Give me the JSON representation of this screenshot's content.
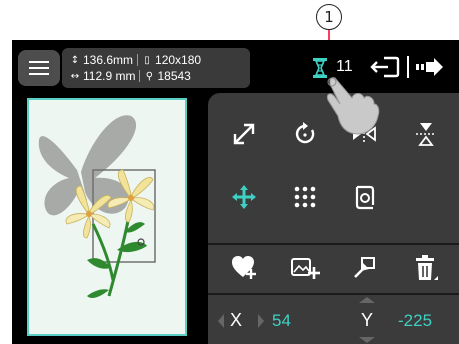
{
  "callout": {
    "number": "1"
  },
  "info": {
    "height_value": "136.6mm",
    "width_value": "112.9 mm",
    "hoop_size": "120x180",
    "stitch_count": "18543"
  },
  "thread": {
    "count": "11"
  },
  "coords": {
    "x_label": "X",
    "x_value": "54",
    "y_label": "Y",
    "y_value": "-225"
  },
  "colors": {
    "accent": "#3fd0c4",
    "panel": "#3b3b3b",
    "callout_line": "#ff3b63"
  },
  "icons": [
    "menu-icon",
    "height-icon",
    "width-icon",
    "hoop-icon",
    "stitch-icon",
    "thread-spool-icon",
    "exit-icon",
    "next-icon",
    "resize-icon",
    "rotate-icon",
    "mirror-horizontal-icon",
    "mirror-vertical-icon",
    "move-icon",
    "array-icon",
    "border-icon",
    "add-favorite-icon",
    "add-image-icon",
    "set-point-icon",
    "delete-icon"
  ]
}
